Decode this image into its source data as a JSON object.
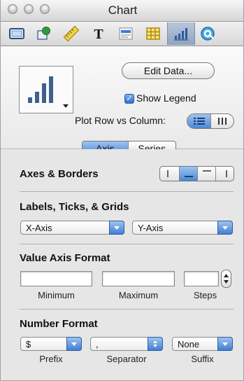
{
  "window": {
    "title": "Chart"
  },
  "toolbar": {
    "items": [
      {
        "name": "document-inspector"
      },
      {
        "name": "graphic-inspector"
      },
      {
        "name": "metrics-inspector"
      },
      {
        "name": "text-inspector"
      },
      {
        "name": "wrap-inspector"
      },
      {
        "name": "table-inspector"
      },
      {
        "name": "chart-inspector",
        "active": true
      },
      {
        "name": "hyperlink-inspector"
      }
    ]
  },
  "chart_panel": {
    "edit_data_label": "Edit Data...",
    "show_legend_label": "Show Legend",
    "show_legend_checked": true,
    "plot_row_vs_column_label": "Plot Row vs Column:"
  },
  "tabs": {
    "axis_label": "Axis",
    "series_label": "Series",
    "selected": "Axis"
  },
  "axes_borders": {
    "heading": "Axes & Borders"
  },
  "labels_ticks_grids": {
    "heading": "Labels, Ticks, & Grids",
    "x_axis_value": "X-Axis",
    "y_axis_value": "Y-Axis"
  },
  "value_axis_format": {
    "heading": "Value Axis Format",
    "minimum_label": "Minimum",
    "maximum_label": "Maximum",
    "steps_label": "Steps",
    "minimum_value": "",
    "maximum_value": "",
    "steps_value": ""
  },
  "number_format": {
    "heading": "Number Format",
    "prefix_value": "$",
    "separator_value": ",",
    "suffix_value": "None",
    "prefix_label": "Prefix",
    "separator_label": "Separator",
    "suffix_label": "Suffix"
  },
  "colors": {
    "accent": "#4a87d8",
    "panel": "#e6e6e6"
  }
}
